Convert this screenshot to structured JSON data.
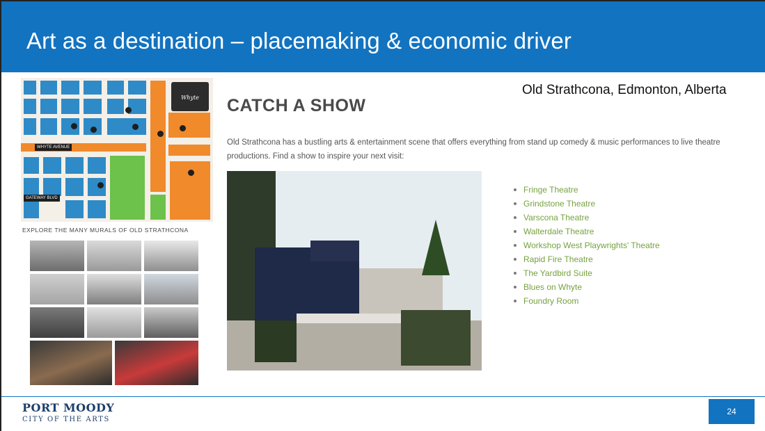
{
  "slide": {
    "title": "Art as a destination – placemaking & economic driver",
    "location": "Old Strathcona, Edmonton, Alberta",
    "page_number": "24"
  },
  "map": {
    "badge_text": "Whyte",
    "street_label_1": "WHYTE AVENUE",
    "street_label_2": "GATEWAY BLVD",
    "caption": "EXPLORE THE MANY MURALS OF OLD STRATHCONA",
    "colors": {
      "residential": "#2e8bc7",
      "commercial": "#f08a2b",
      "park": "#6cc24a"
    }
  },
  "show": {
    "heading": "CATCH A SHOW",
    "description": "Old Strathcona has a bustling arts & entertainment scene that offers everything from stand up comedy & music performances to live theatre productions. Find a show to inspire your next visit:",
    "venues": [
      "Fringe Theatre",
      "Grindstone Theatre",
      "Varscona Theatre",
      "Walterdale Theatre",
      "Workshop West Playwrights' Theatre",
      "Rapid Fire Theatre",
      "The Yardbird Suite",
      "Blues on Whyte",
      "Foundry Room"
    ]
  },
  "footer": {
    "logo_main": "PORT MOODY",
    "logo_sub": "CITY OF THE ARTS",
    "accent": "#1273c0"
  }
}
